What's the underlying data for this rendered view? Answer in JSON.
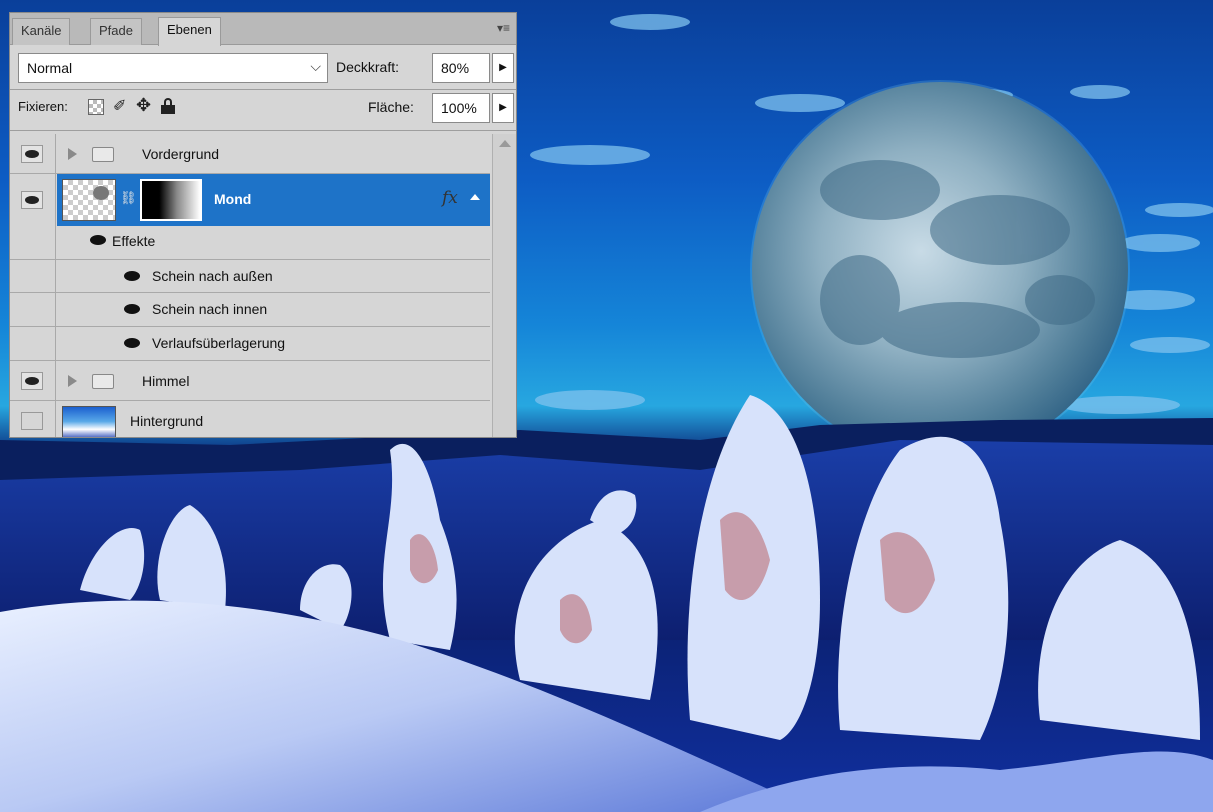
{
  "panel": {
    "tabs": [
      {
        "label": "Kanäle"
      },
      {
        "label": "Pfade"
      },
      {
        "label": "Ebenen"
      }
    ],
    "blend_mode": "Normal",
    "opacity_label": "Deckkraft:",
    "opacity_value": "80%",
    "lock_label": "Fixieren:",
    "fill_label": "Fläche:",
    "fill_value": "100%",
    "layers": [
      {
        "name": "Vordergrund",
        "kind": "group",
        "visible": true
      },
      {
        "name": "Mond",
        "kind": "layer",
        "visible": true,
        "selected": true,
        "fx": "fx"
      },
      {
        "name": "Effekte",
        "kind": "effects-header"
      },
      {
        "name": "Schein nach außen",
        "kind": "effect"
      },
      {
        "name": "Schein nach innen",
        "kind": "effect"
      },
      {
        "name": "Verlaufsüberlagerung",
        "kind": "effect"
      },
      {
        "name": "Himmel",
        "kind": "group",
        "visible": true
      },
      {
        "name": "Hintergrund",
        "kind": "layer",
        "visible": false
      }
    ]
  },
  "icons": {
    "panel_menu": "panel-menu-icon",
    "eye": "eye-icon",
    "folder": "folder-icon",
    "lock": "lock-icon",
    "move": "move-icon",
    "brush": "brush-icon",
    "transparency": "transparency-lock-icon",
    "link": "link-icon",
    "fx": "fx-icon"
  },
  "colors": {
    "panel_bg": "#d6d6d6",
    "selection": "#1e73c8",
    "sky": "#0d5cc4"
  }
}
